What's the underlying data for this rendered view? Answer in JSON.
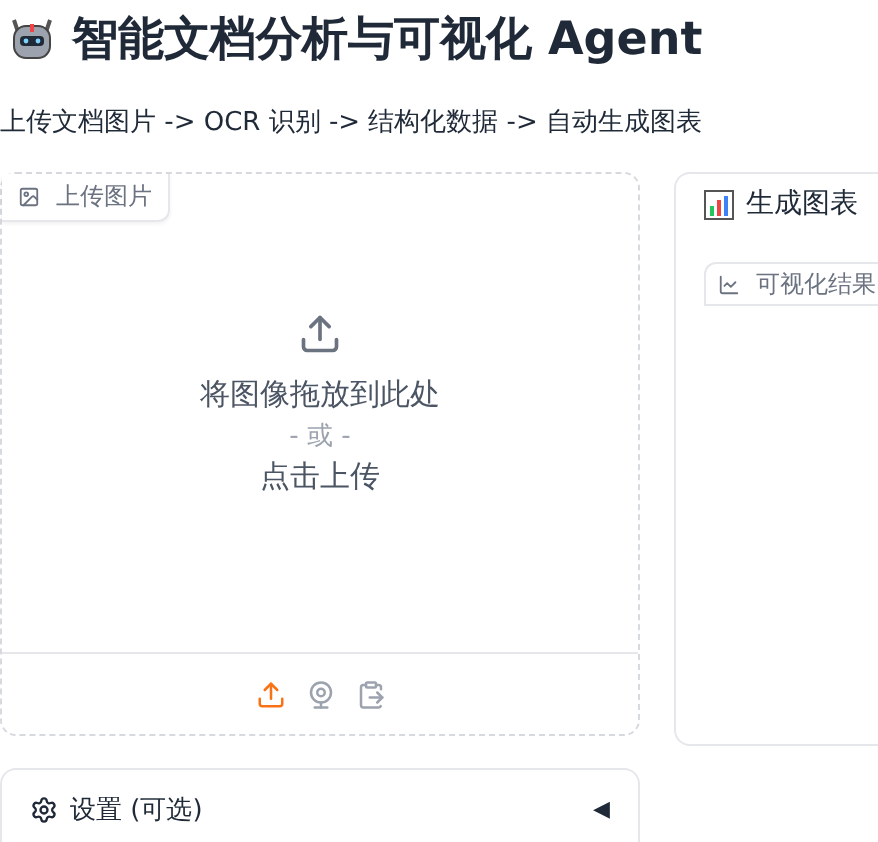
{
  "header": {
    "title": "智能文档分析与可视化 Agent",
    "subtitle": "上传文档图片 -> OCR 识别 -> 结构化数据 -> 自动生成图表"
  },
  "upload": {
    "label": "上传图片",
    "drop_text": "将图像拖放到此处",
    "or_text": "- 或 -",
    "click_text": "点击上传",
    "sources": [
      {
        "kind": "upload",
        "selected": true
      },
      {
        "kind": "webcam",
        "selected": false
      },
      {
        "kind": "clipboard",
        "selected": false
      }
    ]
  },
  "result": {
    "title": "生成图表",
    "label": "可视化结果"
  },
  "settings": {
    "title": "设置 (可选)",
    "toggle": "◀",
    "expanded": false
  }
}
